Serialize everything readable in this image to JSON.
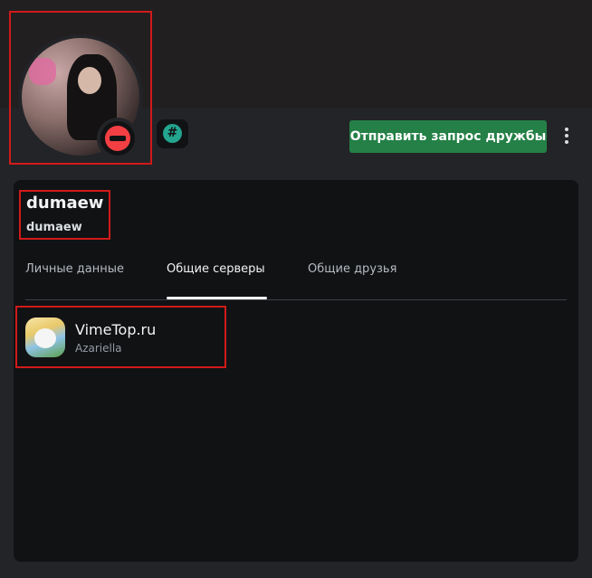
{
  "profile": {
    "display_name": "dumaew",
    "username": "dumaew",
    "status": "do-not-disturb",
    "badge_icon": "hashtag-icon",
    "badge_glyph": "#"
  },
  "actions": {
    "friend_request_label": "Отправить запрос дружбы",
    "more_icon": "more-vertical-icon"
  },
  "tabs": [
    {
      "label": "Личные данные",
      "active": false
    },
    {
      "label": "Общие серверы",
      "active": true
    },
    {
      "label": "Общие друзья",
      "active": false
    }
  ],
  "servers": [
    {
      "name": "VimeTop.ru",
      "nickname": "Azariella"
    }
  ],
  "colors": {
    "accent_green": "#248046",
    "dnd_red": "#f23f43",
    "highlight_red": "#d11a1a",
    "badge_teal": "#23a58f"
  }
}
